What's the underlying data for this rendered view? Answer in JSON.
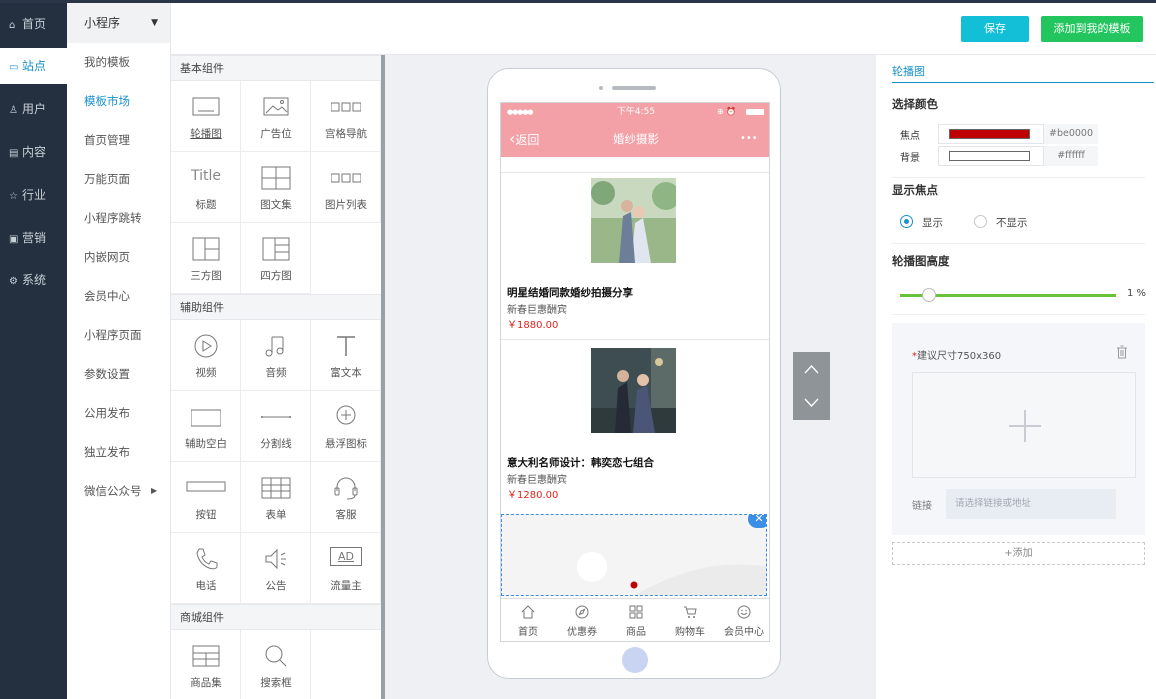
{
  "nav": {
    "items": [
      {
        "label": "首页",
        "icon": "home-icon"
      },
      {
        "label": "站点",
        "icon": "monitor-icon",
        "active": true
      },
      {
        "label": "用户",
        "icon": "user-icon"
      },
      {
        "label": "内容",
        "icon": "content-icon"
      },
      {
        "label": "行业",
        "icon": "star-icon"
      },
      {
        "label": "营销",
        "icon": "card-icon"
      },
      {
        "label": "系统",
        "icon": "gear-icon"
      }
    ]
  },
  "submenu": {
    "header": "小程序",
    "items": [
      "我的模板",
      "模板市场",
      "首页管理",
      "万能页面",
      "小程序跳转",
      "内嵌网页",
      "会员中心",
      "小程序页面",
      "参数设置",
      "公用发布",
      "独立发布",
      "微信公众号"
    ],
    "active_index": 1
  },
  "toolbar": {
    "save_label": "保存",
    "add_label": "添加到我的模板"
  },
  "components": {
    "basic_title": "基本组件",
    "basic": [
      "轮播图",
      "广告位",
      "宫格导航",
      "标题",
      "图文集",
      "图片列表",
      "三方图",
      "四方图"
    ],
    "title_glyph": "Title",
    "aux_title": "辅助组件",
    "aux": [
      "视频",
      "音频",
      "富文本",
      "辅助空白",
      "分割线",
      "悬浮图标",
      "按钮",
      "表单",
      "客服",
      "电话",
      "公告",
      "流量主"
    ],
    "ad_glyph": "AD",
    "mall_title": "商城组件",
    "mall": [
      "商品集",
      "搜索框"
    ]
  },
  "phone": {
    "status_time": "下午4:55",
    "back_label": "返回",
    "page_title": "婚纱摄影",
    "more": "•••",
    "products": [
      {
        "title": "明星结婚同款婚纱拍摄分享",
        "subtitle": "新春巨惠酬宾",
        "price": "￥1880.00"
      },
      {
        "title": "意大利名师设计：韩奕恋七组合",
        "subtitle": "新春巨惠酬宾",
        "price": "￥1280.00"
      }
    ],
    "tabs": [
      "首页",
      "优惠券",
      "商品",
      "购物车",
      "会员中心"
    ]
  },
  "panel": {
    "tab": "轮播图",
    "color_title": "选择颜色",
    "focus_label": "焦点",
    "focus_color": "#be0000",
    "bg_label": "背景",
    "bg_color": "#ffffff",
    "show_focus_title": "显示焦点",
    "show_on": "显示",
    "show_off": "不显示",
    "height_title": "轮播图高度",
    "height_value": "1 %",
    "size_hint": "建议尺寸750x360",
    "link_label": "链接",
    "link_placeholder": "请选择链接或地址",
    "add_label": "+添加"
  },
  "colors": {
    "accent": "#1890c8",
    "header_pink": "#f4a0a7",
    "save": "#12bfd6",
    "add": "#22c55e",
    "nav_bg": "#24303f"
  }
}
